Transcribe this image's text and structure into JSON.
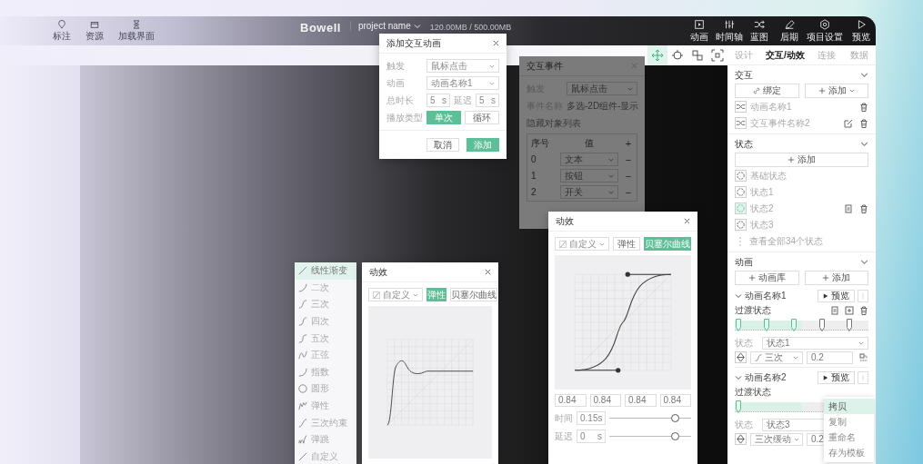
{
  "top_bar": {
    "tools": [
      {
        "label": "标注"
      },
      {
        "label": "资源"
      },
      {
        "label": "加载界面"
      }
    ],
    "logo": "Bowell",
    "project": "project name",
    "storage": "120.00MB / 500.00MB",
    "actions": [
      {
        "label": "动画"
      },
      {
        "label": "时间轴"
      },
      {
        "label": "蓝图"
      },
      {
        "label": "后期"
      },
      {
        "label": "项目设置"
      },
      {
        "label": "预览"
      }
    ]
  },
  "canvas_tools": [
    {
      "selected": true
    },
    {
      "selected": false
    },
    {
      "selected": false
    },
    {
      "selected": false
    }
  ],
  "panel": {
    "tabs": [
      {
        "label": "设计",
        "selected": false
      },
      {
        "label": "交互/动效",
        "selected": true
      },
      {
        "label": "连接",
        "selected": false
      },
      {
        "label": "数据",
        "selected": false
      }
    ],
    "interaction": {
      "title": "交互",
      "bind_button": "绑定",
      "add_button": "添加",
      "items": [
        {
          "label": "动画名称1",
          "editable": false
        },
        {
          "label": "交互事件名称2",
          "editable": true
        }
      ]
    },
    "states": {
      "title": "状态",
      "add_button": "添加",
      "items": [
        {
          "label": "基础状态",
          "selected": false
        },
        {
          "label": "状态1",
          "selected": false
        },
        {
          "label": "状态2",
          "selected": true
        },
        {
          "label": "状态3",
          "selected": false
        }
      ],
      "view_all": "查看全部34个状态"
    },
    "animation": {
      "title": "动画",
      "library_button": "动画库",
      "add_button": "添加",
      "items": [
        {
          "name": "动画名称1",
          "preview": "预览",
          "transition_label": "过渡状态",
          "level": 0.5,
          "keyframes": [
            {
              "active": true
            },
            {
              "active": true
            },
            {
              "active": true
            },
            {
              "active": false
            },
            {
              "active": false
            }
          ],
          "state_label": "状态",
          "state": "状态1",
          "easing": "三次",
          "value": "0.2"
        },
        {
          "name": "动画名称2",
          "preview": "预览",
          "transition_label": "过渡状态",
          "level": 0.5,
          "keyframes": [
            {
              "active": true
            }
          ],
          "state_label": "状态",
          "state": "状态3",
          "easing": "三次缓动",
          "value": "0.2"
        }
      ]
    },
    "context_menu": [
      {
        "label": "拷贝",
        "selected": true
      },
      {
        "label": "复制",
        "selected": false
      },
      {
        "label": "重命名",
        "selected": false
      },
      {
        "label": "存为模板",
        "selected": false
      }
    ]
  },
  "add_animation_dialog": {
    "title": "添加交互动画",
    "fields": [
      {
        "label": "触发",
        "value": "鼠标点击"
      },
      {
        "label": "动画",
        "value": "动画名称1"
      }
    ],
    "duration": {
      "label": "总时长",
      "value": "5",
      "unit": "s"
    },
    "delay": {
      "label": "延迟",
      "value": "5",
      "unit": "s"
    },
    "play_type": {
      "label": "播放类型",
      "options": [
        {
          "label": "单次",
          "selected": true
        },
        {
          "label": "循环",
          "selected": false
        }
      ]
    },
    "cancel": "取消",
    "confirm": "添加"
  },
  "event_dialog": {
    "title": "交互事件",
    "dimmed": true,
    "trigger": {
      "label": "触发",
      "value": "鼠标点击"
    },
    "event_name": {
      "label": "事件名称",
      "value": "多选-2D组件-显示"
    },
    "list_title": "隐藏对象列表",
    "columns": [
      "序号",
      "值"
    ],
    "add_icon": "+",
    "rows": [
      {
        "index": "0",
        "value": "文本",
        "remove": "−"
      },
      {
        "index": "1",
        "value": "按钮",
        "remove": "−"
      },
      {
        "index": "2",
        "value": "开关",
        "remove": "−"
      }
    ]
  },
  "easing_list": [
    {
      "label": "线性渐变",
      "selected": true
    },
    {
      "label": "二次",
      "selected": false
    },
    {
      "label": "三次",
      "selected": false
    },
    {
      "label": "四次",
      "selected": false
    },
    {
      "label": "五次",
      "selected": false
    },
    {
      "label": "正弦",
      "selected": false
    },
    {
      "label": "指数",
      "selected": false
    },
    {
      "label": "圆形",
      "selected": false
    },
    {
      "label": "弹性",
      "selected": false
    },
    {
      "label": "三次约束",
      "selected": false
    },
    {
      "label": "弹跳",
      "selected": false
    },
    {
      "label": "自定义",
      "selected": false
    }
  ],
  "motion_dialogs": [
    {
      "title": "动效",
      "preset": "自定义",
      "kind": "elastic",
      "modes": [
        {
          "label": "弹性",
          "selected": true
        },
        {
          "label": "贝塞尔曲线",
          "selected": false
        }
      ]
    },
    {
      "title": "动效",
      "preset": "自定义",
      "kind": "bezier",
      "modes": [
        {
          "label": "弹性",
          "selected": false
        },
        {
          "label": "贝塞尔曲线",
          "selected": true
        }
      ],
      "control_values": [
        "0.84",
        "0.84",
        "0.84",
        "0.84"
      ],
      "sliders": [
        {
          "label": "时间",
          "value": "0.15",
          "unit": "s",
          "level": 0.8
        },
        {
          "label": "延迟",
          "value": "0",
          "unit": "s",
          "level": 0.8
        }
      ]
    }
  ]
}
